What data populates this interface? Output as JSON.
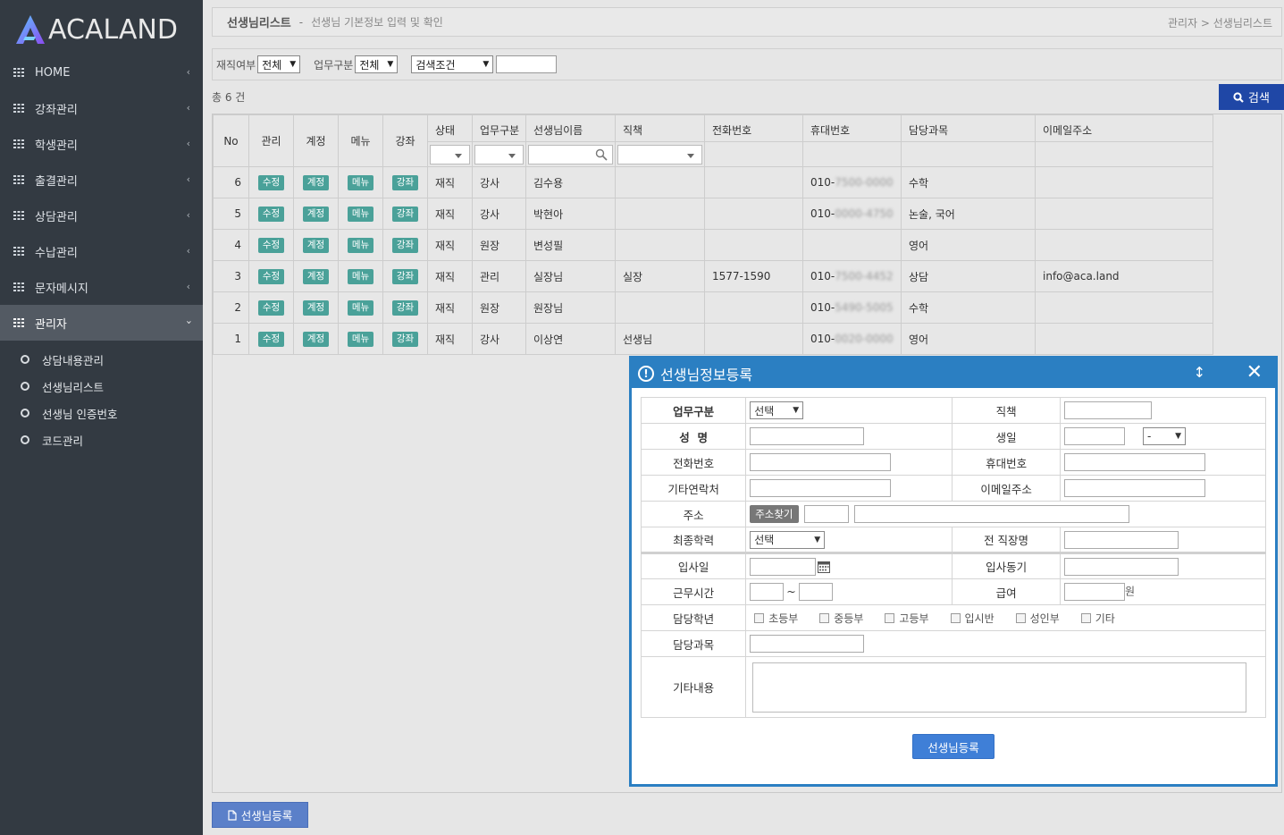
{
  "brand": {
    "name": "ACALAND"
  },
  "sidebar": {
    "items": [
      {
        "label": "HOME"
      },
      {
        "label": "강좌관리"
      },
      {
        "label": "학생관리"
      },
      {
        "label": "출결관리"
      },
      {
        "label": "상담관리"
      },
      {
        "label": "수납관리"
      },
      {
        "label": "문자메시지"
      },
      {
        "label": "관리자"
      }
    ],
    "subitems": [
      {
        "label": "상담내용관리"
      },
      {
        "label": "선생님리스트"
      },
      {
        "label": "선생님 인증번호"
      },
      {
        "label": "코드관리"
      }
    ]
  },
  "header": {
    "title": "선생님리스트",
    "separator": "-",
    "description": "선생님 기본정보 입력 및 확인",
    "breadcrumb": "관리자 > 선생님리스트"
  },
  "filter": {
    "employment_label": "재직여부",
    "employment_value": "전체",
    "work_label": "업무구분",
    "work_value": "전체",
    "condition_value": "검색조건",
    "search_button": "검색"
  },
  "count_text": "총 6 건",
  "table": {
    "headers": [
      "No",
      "관리",
      "계정",
      "메뉴",
      "강좌",
      "상태",
      "업무구분",
      "선생님이름",
      "직책",
      "전화번호",
      "휴대번호",
      "담당과목",
      "이메일주소"
    ],
    "action_labels": {
      "edit": "수정",
      "account": "계정",
      "menu": "메뉴",
      "course": "강좌"
    },
    "rows": [
      {
        "no": "6",
        "status": "재직",
        "type": "강사",
        "name": "김수용",
        "position": "",
        "phone": "",
        "mobile_prefix": "010-",
        "mobile_blur": "7500-0000",
        "subject": "수학",
        "email": ""
      },
      {
        "no": "5",
        "status": "재직",
        "type": "강사",
        "name": "박현아",
        "position": "",
        "phone": "",
        "mobile_prefix": "010-",
        "mobile_blur": "0000-4750",
        "subject": "논술, 국어",
        "email": ""
      },
      {
        "no": "4",
        "status": "재직",
        "type": "원장",
        "name": "변성필",
        "position": "",
        "phone": "",
        "mobile_prefix": "",
        "mobile_blur": "",
        "subject": "영어",
        "email": ""
      },
      {
        "no": "3",
        "status": "재직",
        "type": "관리",
        "name": "실장님",
        "position": "실장",
        "phone": "1577-1590",
        "mobile_prefix": "010-",
        "mobile_blur": "7500-4452",
        "subject": "상담",
        "email": "info@aca.land"
      },
      {
        "no": "2",
        "status": "재직",
        "type": "원장",
        "name": "원장님",
        "position": "",
        "phone": "",
        "mobile_prefix": "010-",
        "mobile_blur": "5490-5005",
        "subject": "수학",
        "email": ""
      },
      {
        "no": "1",
        "status": "재직",
        "type": "강사",
        "name": "이상연",
        "position": "선생님",
        "phone": "",
        "mobile_prefix": "010-",
        "mobile_blur": "0020-0000",
        "subject": "영어",
        "email": ""
      }
    ]
  },
  "register_button": "선생님등록",
  "modal": {
    "title": "선생님정보등록",
    "labels": {
      "work_type": "업무구분",
      "position": "직책",
      "name": "성  명",
      "birthday": "생일",
      "phone": "전화번호",
      "mobile": "휴대번호",
      "other_contact": "기타연락처",
      "email": "이메일주소",
      "address": "주소",
      "education": "최종학력",
      "prev_job": "전 직장명",
      "join_date": "입사일",
      "motive": "입사동기",
      "work_hours": "근무시간",
      "salary": "급여",
      "grades": "담당학년",
      "subject": "담당과목",
      "etc": "기타내용"
    },
    "work_type_value": "선택",
    "birthday_type_value": "-",
    "address_button": "주소찾기",
    "education_value": "선택",
    "tilde": "~",
    "won": "원",
    "grades": [
      "초등부",
      "중등부",
      "고등부",
      "입시반",
      "성인부",
      "기타"
    ],
    "submit": "선생님등록"
  }
}
